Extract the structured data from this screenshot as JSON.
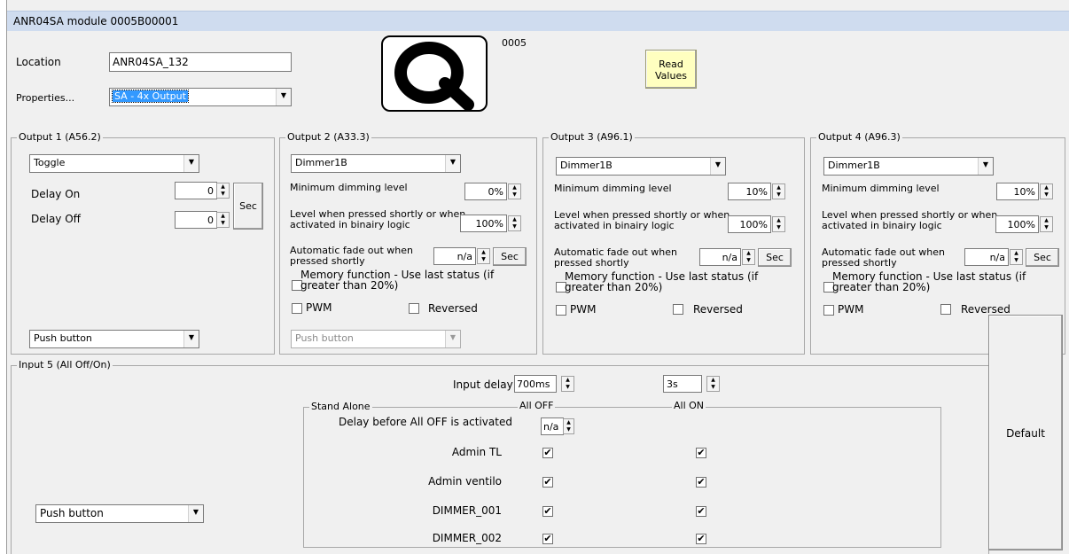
{
  "window": {
    "title": "ANR04SA module 0005B00001"
  },
  "header": {
    "location_label": "Location",
    "location_value": "ANR04SA_132",
    "properties_label": "Properties...",
    "properties_value": "SA - 4x Output",
    "module_code": "0005",
    "read_values_label": "Read\nValues"
  },
  "output1": {
    "title": "Output 1 (A56.2)",
    "mode": "Toggle",
    "delay_on_label": "Delay On",
    "delay_on_value": "0",
    "delay_off_label": "Delay Off",
    "delay_off_value": "0",
    "sec_label": "Sec",
    "input_type": "Push button"
  },
  "output2": {
    "title": "Output 2 (A33.3)",
    "mode": "Dimmer1B",
    "min_dim_label": "Minimum dimming level",
    "min_dim_value": "0%",
    "level_label": "Level when pressed shortly or when activated in binairy logic",
    "level_value": "100%",
    "fade_label": "Automatic fade out when pressed shortly",
    "fade_value": "n/a",
    "sec_label": "Sec",
    "memory_label": "Memory function - Use last status (if greater than 20%)",
    "pwm_label": "PWM",
    "reversed_label": "Reversed",
    "input_type": "Push button"
  },
  "output3": {
    "title": "Output 3 (A96.1)",
    "mode": "Dimmer1B",
    "min_dim_label": "Minimum dimming level",
    "min_dim_value": "10%",
    "level_label": "Level when pressed shortly or when activated in binairy logic",
    "level_value": "100%",
    "fade_label": "Automatic fade out when pressed shortly",
    "fade_value": "n/a",
    "sec_label": "Sec",
    "memory_label": "Memory function - Use last status (if greater than 20%)",
    "pwm_label": "PWM",
    "reversed_label": "Reversed"
  },
  "output4": {
    "title": "Output 4 (A96.3)",
    "mode": "Dimmer1B",
    "min_dim_label": "Minimum dimming level",
    "min_dim_value": "10%",
    "level_label": "Level when pressed shortly or when activated in binairy logic",
    "level_value": "100%",
    "fade_label": "Automatic fade out when pressed shortly",
    "fade_value": "n/a",
    "sec_label": "Sec",
    "memory_label": "Memory function - Use last status (if greater than 20%)",
    "pwm_label": "PWM",
    "reversed_label": "Reversed"
  },
  "input5": {
    "title": "Input 5 (All Off/On)",
    "input_delay_label": "Input delay",
    "input_delay_value": "700ms",
    "second_delay_value": "3s",
    "input_type": "Push button",
    "standalone_title": "Stand Alone",
    "all_off_label": "All OFF",
    "all_on_label": "All ON",
    "delay_before_label": "Delay before All OFF is activated",
    "delay_before_value": "n/a",
    "rows": [
      {
        "name": "Admin TL",
        "off": true,
        "on": true
      },
      {
        "name": "Admin ventilo",
        "off": true,
        "on": true
      },
      {
        "name": "DIMMER_001",
        "off": true,
        "on": true
      },
      {
        "name": "DIMMER_002",
        "off": true,
        "on": true
      }
    ]
  },
  "default_label": "Default",
  "icons": {
    "logo": "q-logo-icon",
    "dropdown": "chevron-down-icon",
    "spin": "spin-arrows-icon",
    "check": "checkmark-icon"
  },
  "colors": {
    "title_bar": "#cfdcef",
    "read_button": "#ffffc0",
    "selection": "#3399ff"
  }
}
